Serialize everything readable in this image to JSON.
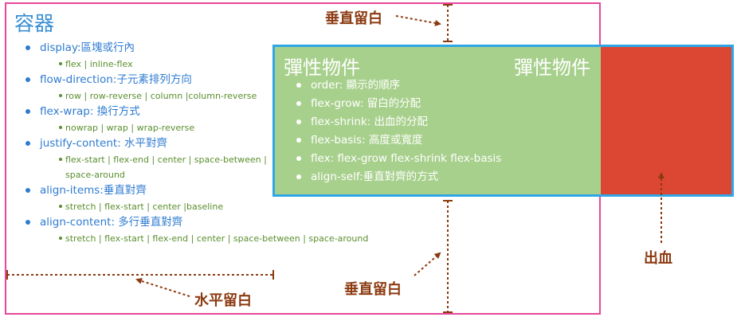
{
  "container": {
    "title": "容器",
    "properties": [
      {
        "name": "display:區塊或行內",
        "values": [
          "flex | inline-flex"
        ]
      },
      {
        "name": "flow-direction:子元素排列方向",
        "values": [
          "row | row-reverse | column |column-reverse"
        ]
      },
      {
        "name": "flex-wrap: 換行方式",
        "values": [
          "nowrap | wrap | wrap-reverse"
        ]
      },
      {
        "name": "justify-content: 水平對齊",
        "values": [
          "flex-start | flex-end | center | space-between |",
          "space-around"
        ]
      },
      {
        "name": "align-items:垂直對齊",
        "values": [
          "stretch | flex-start | center |baseline"
        ]
      },
      {
        "name": "align-content: 多行垂直對齊",
        "values": [
          "stretch | flex-start | flex-end | center | space-between | space-around"
        ]
      }
    ]
  },
  "flex_item": {
    "title": "彈性物件",
    "properties": [
      "order: 顯示的順序",
      "flex-grow: 留白的分配",
      "flex-shrink: 出血的分配",
      "flex-basis: 高度或寬度",
      "flex: flex-grow flex-shrink flex-basis",
      "align-self:垂直對齊的方式"
    ]
  },
  "flex_item_2": {
    "title": "彈性物件"
  },
  "labels": {
    "vertical_margin_top": "垂直留白",
    "vertical_margin_bottom": "垂直留白",
    "horizontal_margin": "水平留白",
    "bleed": "出血"
  },
  "colors": {
    "container_border": "#e8479a",
    "item_border": "#2fa6e6",
    "item_fill": "#a8d08d",
    "bleed_fill": "#dc4734",
    "label_text": "#8b3a10",
    "container_text": "#2e7bd0",
    "values_text": "#5a8f2e"
  }
}
